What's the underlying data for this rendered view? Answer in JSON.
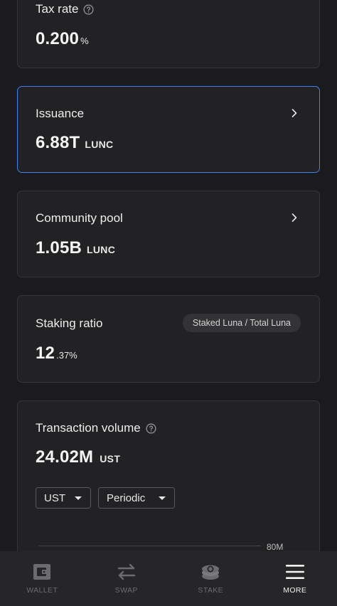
{
  "tax_rate": {
    "title": "Tax rate",
    "value": "0.200",
    "suffix": "%"
  },
  "issuance": {
    "title": "Issuance",
    "value": "6.88T",
    "unit": "LUNC"
  },
  "community_pool": {
    "title": "Community pool",
    "value": "1.05B",
    "unit": "LUNC"
  },
  "staking_ratio": {
    "title": "Staking ratio",
    "badge": "Staked Luna / Total Luna",
    "value": "12",
    "suffix": ".37%"
  },
  "transaction_volume": {
    "title": "Transaction volume",
    "value": "24.02M",
    "unit": "UST",
    "denom_select": "UST",
    "period_select": "Periodic",
    "axis_label": "80M"
  },
  "nav": {
    "items": [
      {
        "label": "WALLET",
        "icon": "wallet-icon",
        "active": false
      },
      {
        "label": "SWAP",
        "icon": "swap-icon",
        "active": false
      },
      {
        "label": "STAKE",
        "icon": "stake-icon",
        "active": false
      },
      {
        "label": "MORE",
        "icon": "menu-icon",
        "active": true
      }
    ]
  },
  "colors": {
    "background": "#1b1b1d",
    "card": "#222224",
    "accent": "#3b82f6",
    "inactive_nav": "#6b6b70"
  }
}
